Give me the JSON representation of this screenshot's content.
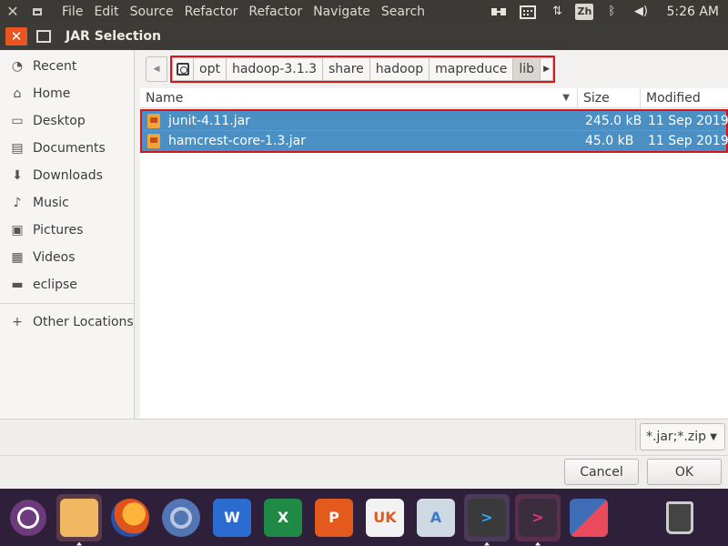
{
  "top_panel": {
    "menu": [
      "File",
      "Edit",
      "Source",
      "Refactor",
      "Refactor",
      "Navigate",
      "Search"
    ],
    "lang": "Zh",
    "time": "5:26 AM",
    "icons": [
      "close-icon",
      "minimize-icon",
      "pointer-tray-icon",
      "calendar-tray-icon",
      "network-transfer-icon",
      "keyboard-language-icon",
      "bluetooth-icon",
      "volume-icon"
    ]
  },
  "dialog": {
    "title": "JAR Selection"
  },
  "sidebar": {
    "items": [
      {
        "label": "Recent",
        "icon": "clock-icon"
      },
      {
        "label": "Home",
        "icon": "home-icon"
      },
      {
        "label": "Desktop",
        "icon": "desktop-icon"
      },
      {
        "label": "Documents",
        "icon": "document-icon"
      },
      {
        "label": "Downloads",
        "icon": "download-icon"
      },
      {
        "label": "Music",
        "icon": "music-icon"
      },
      {
        "label": "Pictures",
        "icon": "picture-icon"
      },
      {
        "label": "Videos",
        "icon": "video-icon"
      },
      {
        "label": "eclipse",
        "icon": "folder-icon"
      }
    ],
    "other": "Other Locations"
  },
  "pathbar": {
    "crumbs": [
      "opt",
      "hadoop-3.1.3",
      "share",
      "hadoop",
      "mapreduce",
      "lib"
    ],
    "active": "lib"
  },
  "filelist": {
    "columns": {
      "name": "Name",
      "size": "Size",
      "modified": "Modified"
    },
    "rows": [
      {
        "name": "junit-4.11.jar",
        "size": "245.0 kB",
        "modified": "11 Sep 2019"
      },
      {
        "name": "hamcrest-core-1.3.jar",
        "size": "45.0 kB",
        "modified": "11 Sep 2019"
      }
    ]
  },
  "filter": {
    "selected": "*.jar;*.zip"
  },
  "buttons": {
    "cancel": "Cancel",
    "ok": "OK"
  },
  "dock": {
    "apps": [
      "ubuntu-icon",
      "files-icon",
      "firefox-icon",
      "chromium-icon",
      "word-icon",
      "excel-icon",
      "powerpoint-icon",
      "software-store-icon",
      "android-studio-icon",
      "vscode-icon",
      "terminal-icon",
      "flat-app-icon",
      "trash-icon"
    ],
    "labels": {
      "word": "W",
      "excel": "X",
      "ppt": "P",
      "store": "UK",
      "android": "A",
      "vscode": ">",
      "term": ">"
    }
  }
}
